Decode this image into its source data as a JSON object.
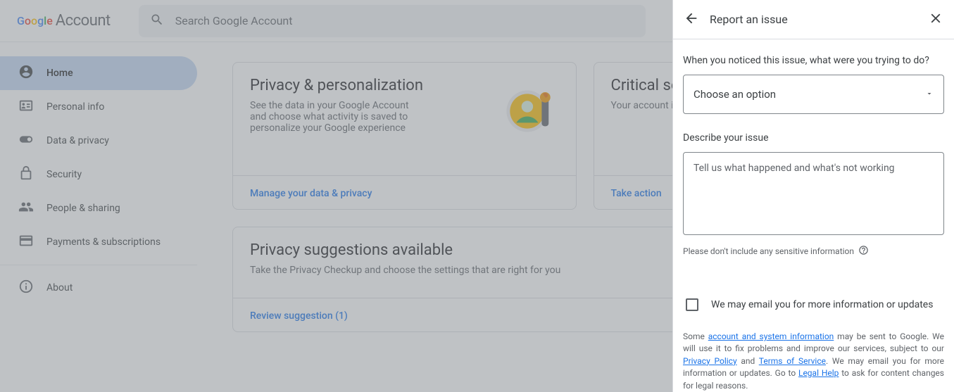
{
  "header": {
    "logo_account": "Account",
    "search_placeholder": "Search Google Account"
  },
  "sidebar": {
    "items": [
      {
        "label": "Home"
      },
      {
        "label": "Personal info"
      },
      {
        "label": "Data & privacy"
      },
      {
        "label": "Security"
      },
      {
        "label": "People & sharing"
      },
      {
        "label": "Payments & subscriptions"
      }
    ],
    "about": "About"
  },
  "cards": {
    "privacy": {
      "title": "Privacy & personalization",
      "desc": "See the data in your Google Account and choose what activity is saved to personalize your Google experience",
      "link": "Manage your data & privacy"
    },
    "security": {
      "title": "Critical security issues found",
      "desc": "Your account is at risk, secure it now",
      "link": "Take action"
    },
    "suggestions": {
      "title": "Privacy suggestions available",
      "desc": "Take the Privacy Checkup and choose the settings that are right for you",
      "link": "Review suggestion (1)"
    }
  },
  "panel": {
    "title": "Report an issue",
    "q1": "When you noticed this issue, what were you trying to do?",
    "select_placeholder": "Choose an option",
    "q2": "Describe your issue",
    "textarea_placeholder": "Tell us what happened and what's not working",
    "hint": "Please don't include any sensitive information",
    "email_opt": "We may email you for more information or updates",
    "legal_1": "Some ",
    "legal_link1": "account and system information",
    "legal_2": " may be sent to Google. We will use it to fix problems and improve our services, subject to our ",
    "legal_link2": "Privacy Policy",
    "legal_3": " and ",
    "legal_link3": "Terms of Service",
    "legal_4": ". We may email you for more information or updates. Go to ",
    "legal_link4": "Legal Help",
    "legal_5": " to ask for content changes for legal reasons."
  }
}
